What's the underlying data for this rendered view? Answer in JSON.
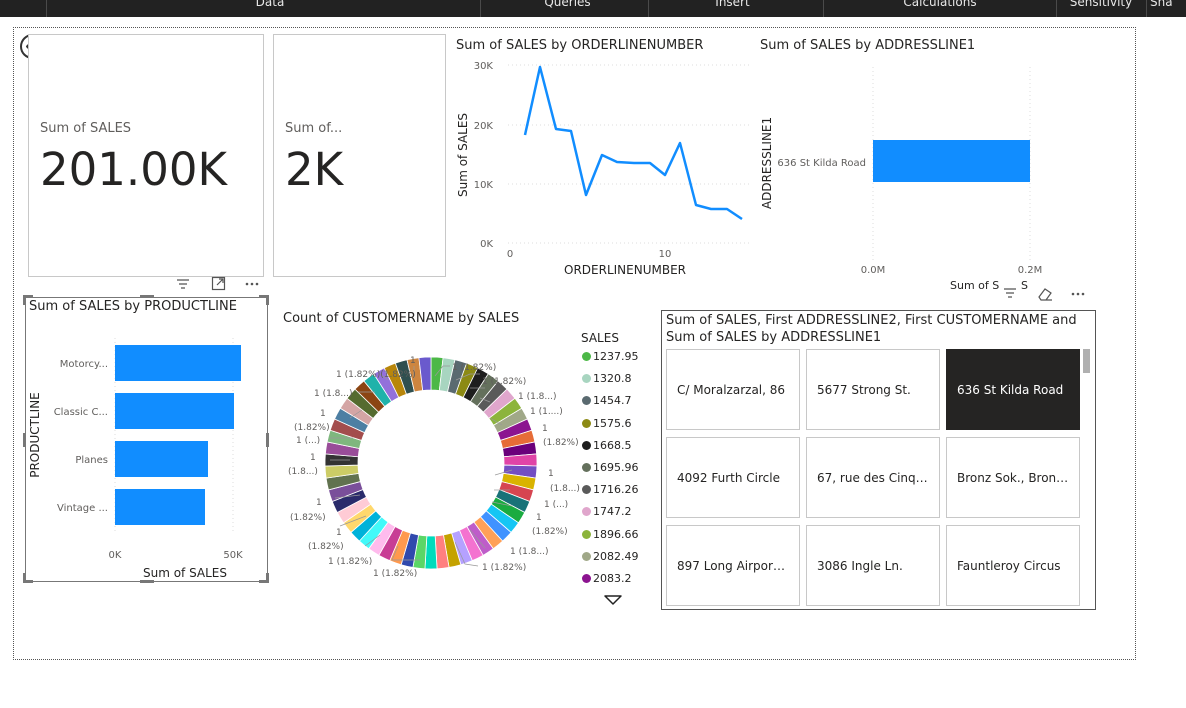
{
  "ribbon": {
    "tabs": [
      "Data",
      "Queries",
      "Insert",
      "Calculations",
      "Sensitivity",
      "Sha"
    ]
  },
  "back_icon": "back-arrow-icon",
  "cards": {
    "sales": {
      "label": "Sum of SALES",
      "value": "201.00K"
    },
    "second": {
      "label": "Sum of...",
      "value": "2K"
    }
  },
  "line_chart": {
    "title": "Sum of SALES by ORDERLINENUMBER",
    "xlabel": "ORDERLINENUMBER",
    "ylabel": "Sum of SALES",
    "yticks": [
      "30K",
      "20K",
      "10K",
      "0K"
    ],
    "xticks": [
      "0",
      "10"
    ],
    "color": "#118DFF"
  },
  "addr_chart": {
    "title": "Sum of SALES by ADDRESSLINE1",
    "ylabel": "ADDRESSLINE1",
    "category": "636 St Kilda Road",
    "xticks": [
      "0.0M",
      "0.2M"
    ],
    "xlabel_partial": "Sum of S",
    "color": "#118DFF"
  },
  "product_chart": {
    "title": "Sum of SALES by PRODUCTLINE",
    "ylabel": "PRODUCTLINE",
    "xlabel": "Sum of SALES",
    "categories": [
      "Motorcy...",
      "Classic C...",
      "Planes",
      "Vintage ..."
    ],
    "xticks": [
      "0K",
      "50K"
    ],
    "color": "#118DFF"
  },
  "donut": {
    "title": "Count of CUSTOMERNAME by SALES",
    "legend_title": "SALES",
    "legend": [
      {
        "label": "1237.95",
        "color": "#4CB847"
      },
      {
        "label": "1320.8",
        "color": "#A8D5C0"
      },
      {
        "label": "1454.7",
        "color": "#5A6A70"
      },
      {
        "label": "1575.6",
        "color": "#8C8A14"
      },
      {
        "label": "1668.5",
        "color": "#1E1E1E"
      },
      {
        "label": "1695.96",
        "color": "#64705C"
      },
      {
        "label": "1716.26",
        "color": "#5A5A5A"
      },
      {
        "label": "1747.2",
        "color": "#E0A6CC"
      },
      {
        "label": "1896.66",
        "color": "#8CB43C"
      },
      {
        "label": "2082.49",
        "color": "#A0A888"
      },
      {
        "label": "2083.2",
        "color": "#8C1490"
      }
    ],
    "labels": {
      "top_center": "1",
      "top_left": "1 (1.82%)(1.82%)",
      "top_right": "1 (1.82%)",
      "r1": "1 (1.82%)",
      "r2": "1 (1.8...)",
      "r3": "1 (1....)",
      "r4": "1",
      "r5": "(1.82%)",
      "l1": "1 (1.8...)",
      "l2": "1",
      "l3": "(1.82%)",
      "l4": "1 (...)",
      "l5": "1",
      "l6": "(1.8...)",
      "r6": "1",
      "r7": "(1.8...)",
      "r8": "1 (...)",
      "r9": "1",
      "r10": "(1.82%)",
      "l7": "1",
      "l8": "(1.82%)",
      "l9": "1",
      "l10": "(1.82%)",
      "bl": "1 (1.82%)",
      "bc": "1 (1.82%)",
      "br1": "1 (1.8...)",
      "br2": "1 (1.82%)"
    }
  },
  "slicer": {
    "title": "Sum of SALES, First ADDRESSLINE2, First CUSTOMERNAME and Sum of SALES by ADDRESSLINE1",
    "items": [
      "C/ Moralzarzal, 86",
      "5677 Strong St.",
      "636 St Kilda Road",
      "4092 Furth Circle",
      "67, rue des Cinqu...",
      "Bronz Sok., Bronz ...",
      "897 Long Airport ...",
      "3086 Ingle Ln.",
      "Fauntleroy Circus"
    ],
    "selected_index": 2
  },
  "hover_partial": "S"
}
